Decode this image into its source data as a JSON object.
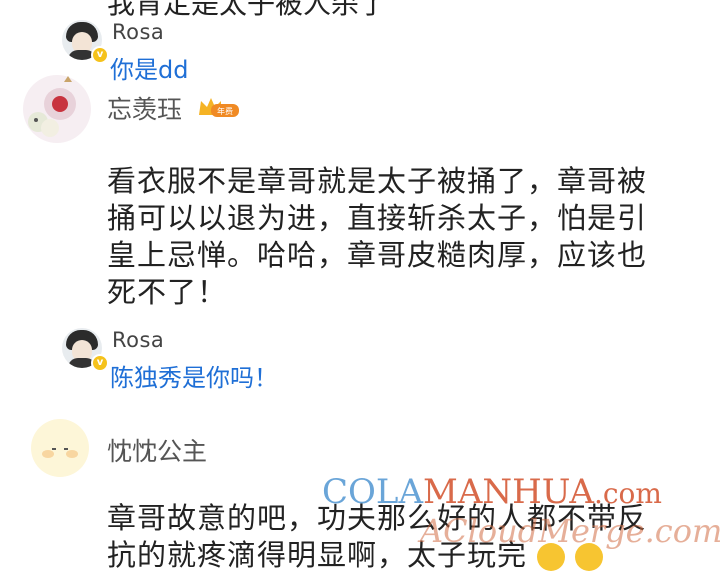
{
  "thread": {
    "top_cut_text": "我肯定是太子被人杀了",
    "reply1": {
      "name": "Rosa",
      "text": "你是dd"
    },
    "comment1": {
      "user": "忘羡珏",
      "vip_badge": "年费",
      "lines": [
        "看衣服不是章哥就是太子被捅了，章哥被",
        "捅可以以退为进，直接斩杀太子，怕是引",
        "皇上忌惮。哈哈，章哥皮糙肉厚，应该也",
        "死不了！"
      ]
    },
    "reply2": {
      "name": "Rosa",
      "text": "陈独秀是你吗！"
    },
    "comment2": {
      "user": "忱忱公主",
      "lines": [
        "章哥故意的吧，功夫那么好的人都不带反",
        "抗的就疼滴得明显啊，太子玩完"
      ]
    }
  },
  "watermark": {
    "top": "COLAMANHUA.com",
    "bottom": "ACloudMerge.com"
  },
  "colors": {
    "link_blue": "#1f6fd6",
    "badge_gold": "#f5c21b",
    "vip_orange": "#f08a24"
  }
}
